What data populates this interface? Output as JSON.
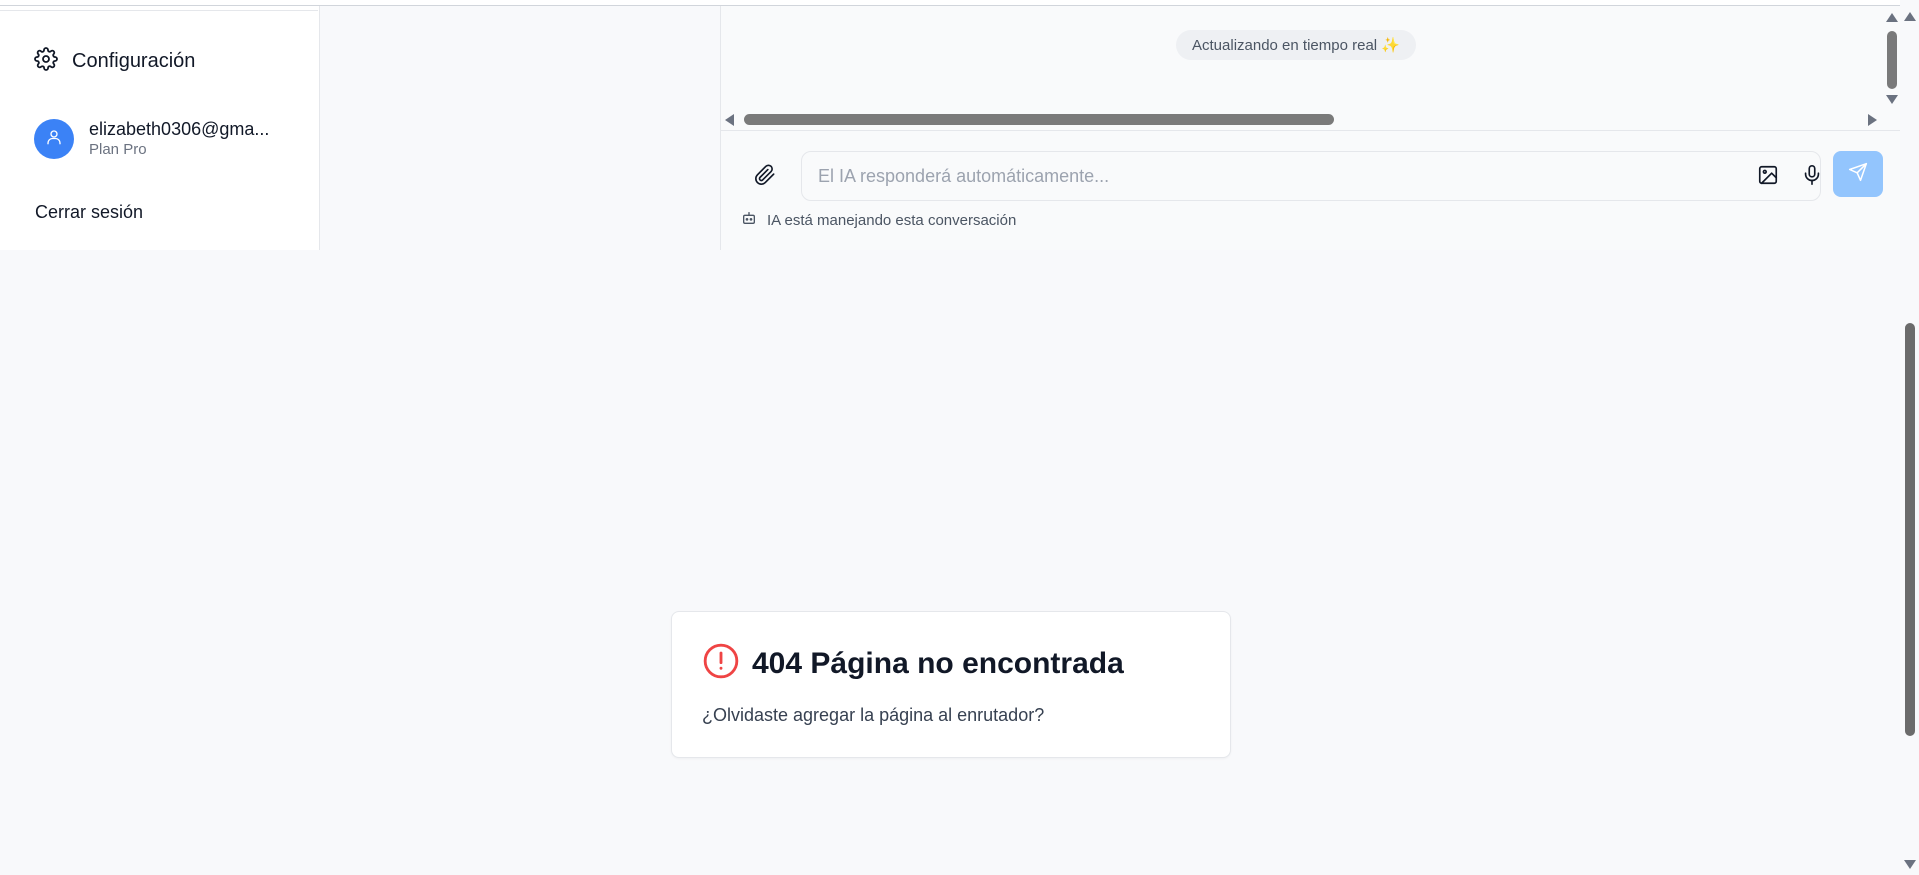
{
  "sidebar": {
    "settings": {
      "label": "Configuración",
      "icon": "gear-icon"
    },
    "user": {
      "email": "elizabeth0306@gma...",
      "plan": "Plan Pro",
      "avatar_icon": "user-icon",
      "avatar_color": "#3b82f6"
    },
    "logout_label": "Cerrar sesión"
  },
  "chat": {
    "status_chip": "Actualizando en tiempo real ✨",
    "input": {
      "placeholder": "El IA responderá automáticamente...",
      "value": ""
    },
    "ai_status": "IA está manejando esta conversación",
    "send_color": "#93c5fd"
  },
  "error": {
    "title": "404 Página no encontrada",
    "subtitle": "¿Olvidaste agregar la página al enrutador?",
    "icon_color": "#ef4444"
  }
}
